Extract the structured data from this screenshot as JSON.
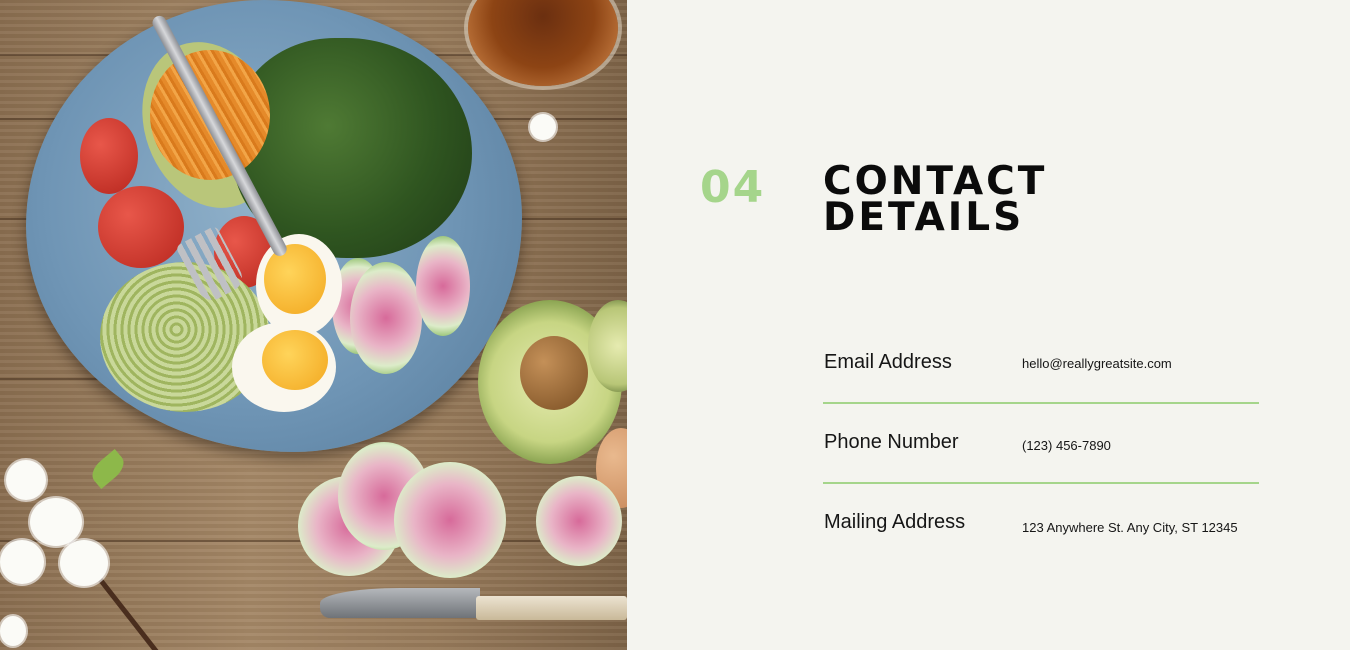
{
  "photo": {
    "description_icon": "food-photo"
  },
  "section": {
    "number": "04",
    "title_line1": "CONTACT",
    "title_line2": "DETAILS"
  },
  "contacts": [
    {
      "label": "Email Address",
      "value": "hello@reallygreatsite.com"
    },
    {
      "label": "Phone Number",
      "value": "(123) 456-7890"
    },
    {
      "label": "Mailing Address",
      "value": "123 Anywhere St. Any City, ST 12345"
    }
  ],
  "colors": {
    "accent": "#a5d58b",
    "background": "#f4f4ef",
    "text": "#0b0b0b"
  }
}
